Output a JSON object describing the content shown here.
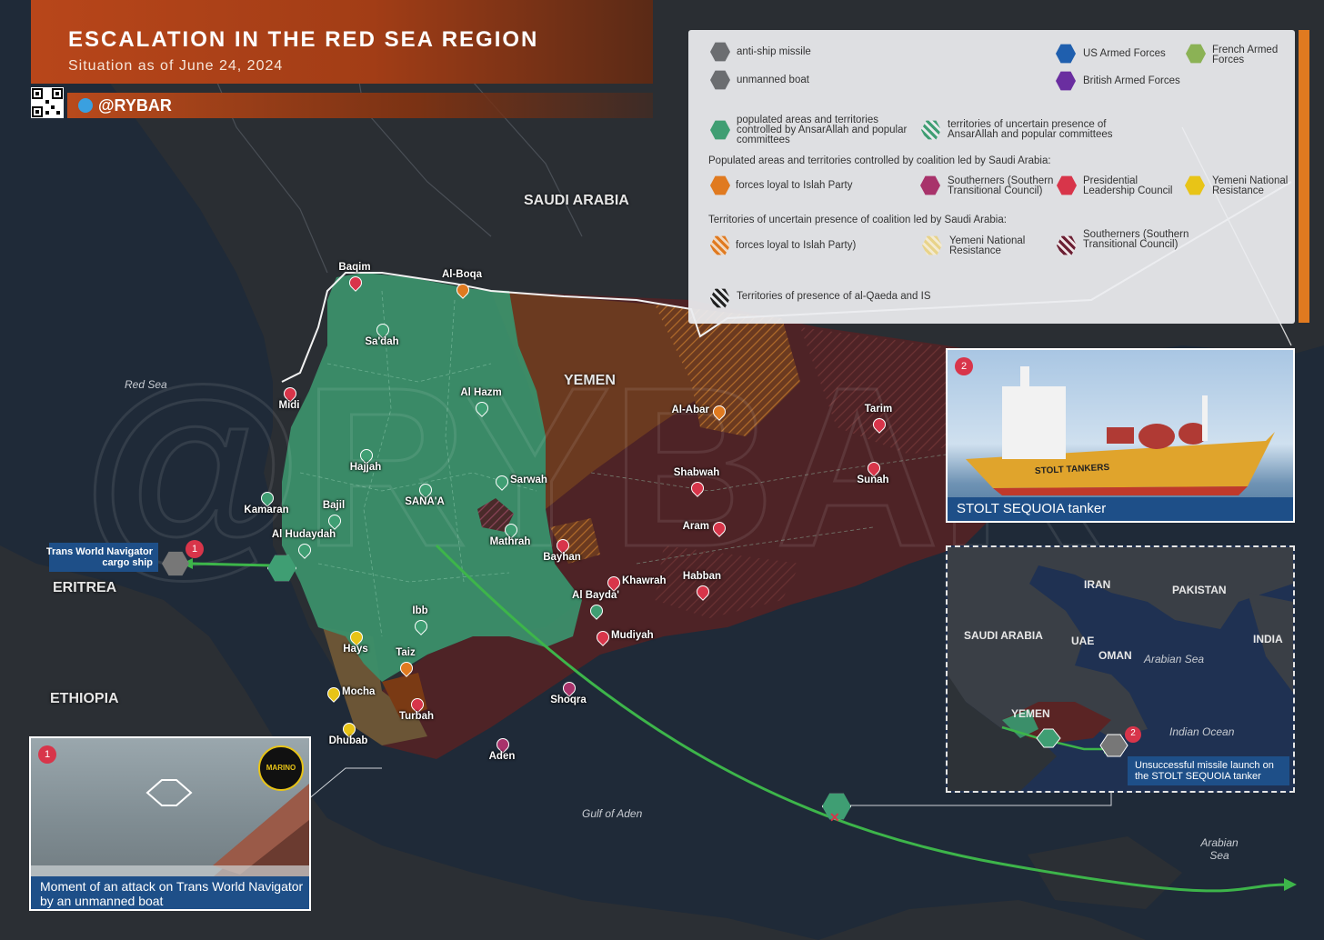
{
  "header": {
    "title": "ESCALATION IN THE RED SEA REGION",
    "subtitle": "Situation as of June 24, 2024",
    "telegram": "@RYBAR"
  },
  "legend": {
    "missile": "anti-ship missile",
    "boat": "unmanned boat",
    "us": "US Armed Forces",
    "french": "French Armed Forces",
    "british": "British Armed Forces",
    "ansar_controlled": "populated areas and territories controlled by AnsarAllah and popular committees",
    "ansar_uncertain": "territories of uncertain presence of AnsarAllah and popular committees",
    "coalition_header": "Populated areas and territories controlled by coalition led by Saudi Arabia:",
    "islah": "forces loyal to Islah Party",
    "stc": "Southerners (Southern Transitional Council)",
    "plc": "Presidential Leadership Council",
    "ynr": "Yemeni National Resistance",
    "uncertain_header": "Territories of uncertain presence of coalition led by Saudi Arabia:",
    "islah_u": "forces loyal to Islah Party)",
    "ynr_u": "Yemeni National Resistance",
    "stc_u": "Southerners (Southern Transitional Council)",
    "aqap": "Territories of presence of al-Qaeda and IS"
  },
  "colors": {
    "ansar": "#3f9e73",
    "islah": "#e07a20",
    "stc": "#a8336b",
    "plc": "#d8354a",
    "ynr": "#e8c417",
    "us": "#1f5fae",
    "french": "#8bb255",
    "british": "#6a2ea0",
    "coalition_territory": "#5a2424",
    "islah_territory": "#6b3a20"
  },
  "countries": {
    "saudi": "SAUDI ARABIA",
    "yemen": "YEMEN",
    "eritrea": "ERITREA",
    "ethiopia": "ETHIOPIA"
  },
  "seas": {
    "red_sea": "Red Sea",
    "gulf_aden": "Gulf of Aden",
    "arabian": "Arabian Sea"
  },
  "cities": [
    {
      "name": "Baqim",
      "color": "#d8354a"
    },
    {
      "name": "Al-Boqa",
      "color": "#e07a20"
    },
    {
      "name": "Sa'dah",
      "color": "#3f9e73"
    },
    {
      "name": "Midi",
      "color": "#d8354a"
    },
    {
      "name": "Al Hazm",
      "color": "#3f9e73"
    },
    {
      "name": "Hajjah",
      "color": "#3f9e73"
    },
    {
      "name": "Sarwah",
      "color": "#3f9e73"
    },
    {
      "name": "Kamaran",
      "color": "#3f9e73"
    },
    {
      "name": "Bajil",
      "color": "#3f9e73"
    },
    {
      "name": "SANA'A",
      "color": "#3f9e73"
    },
    {
      "name": "Al Hudaydah",
      "color": "#3f9e73"
    },
    {
      "name": "Mathrah",
      "color": "#3f9e73"
    },
    {
      "name": "Bayhan",
      "color": "#d8354a"
    },
    {
      "name": "Khawrah",
      "color": "#d8354a"
    },
    {
      "name": "Habban",
      "color": "#d8354a"
    },
    {
      "name": "Al Bayda'",
      "color": "#3f9e73"
    },
    {
      "name": "Mudiyah",
      "color": "#d8354a"
    },
    {
      "name": "Ibb",
      "color": "#3f9e73"
    },
    {
      "name": "Hays",
      "color": "#e8c417"
    },
    {
      "name": "Taiz",
      "color": "#e07a20"
    },
    {
      "name": "Mocha",
      "color": "#e8c417"
    },
    {
      "name": "Turbah",
      "color": "#d8354a"
    },
    {
      "name": "Dhubab",
      "color": "#e8c417"
    },
    {
      "name": "Aden",
      "color": "#a8336b"
    },
    {
      "name": "Shoqra",
      "color": "#a8336b"
    },
    {
      "name": "Al-Abar",
      "color": "#e07a20"
    },
    {
      "name": "Shabwah",
      "color": "#d8354a"
    },
    {
      "name": "Aram",
      "color": "#d8354a"
    },
    {
      "name": "Tarim",
      "color": "#d8354a"
    },
    {
      "name": "Sunah",
      "color": "#d8354a"
    }
  ],
  "events": {
    "ship1_label": "Trans World Navigator cargo ship",
    "ship1_num": "1",
    "photo1_caption": "Moment of an attack on Trans World Navigator by an unmanned boat",
    "photo1_num": "1",
    "photo1_badge": "MARINO",
    "photo2_caption": "STOLT SEQUOIA tanker",
    "photo2_num": "2",
    "hull_text": "STOLT TANKERS",
    "inset_caption": "Unsuccessful missile launch on the STOLT SEQUOIA tanker",
    "inset_num": "2"
  },
  "inset": {
    "iran": "IRAN",
    "pakistan": "PAKISTAN",
    "saudi": "SAUDI ARABIA",
    "uae": "UAE",
    "oman": "OMAN",
    "arabian_sea": "Arabian Sea",
    "india": "INDIA",
    "yemen": "YEMEN",
    "indian_ocean": "Indian Ocean"
  }
}
